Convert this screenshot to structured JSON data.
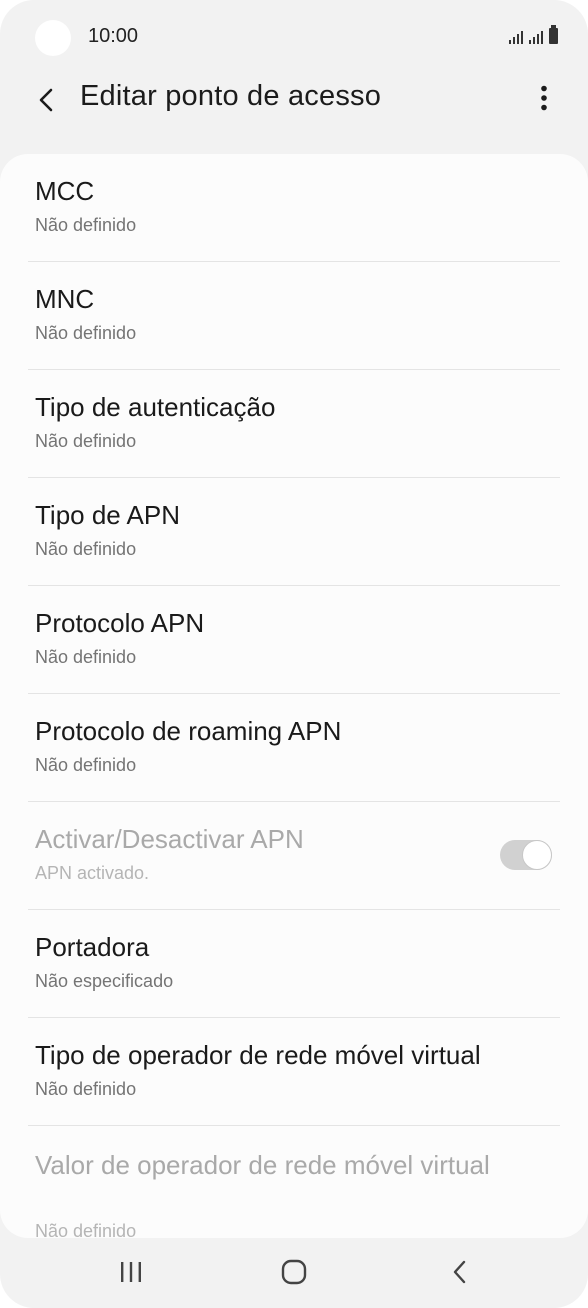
{
  "status_bar": {
    "time": "10:00",
    "icons": [
      "signal-icon",
      "signal-icon",
      "battery-icon"
    ]
  },
  "app_bar": {
    "title": "Editar ponto de acesso",
    "back_icon": "chevron-left-icon",
    "more_icon": "more-vertical-icon"
  },
  "settings": {
    "mcc": {
      "title": "MCC",
      "value": "Não definido"
    },
    "mnc": {
      "title": "MNC",
      "value": "Não definido"
    },
    "auth_type": {
      "title": "Tipo de autenticação",
      "value": "Não definido"
    },
    "apn_type": {
      "title": "Tipo de APN",
      "value": "Não definido"
    },
    "apn_protocol": {
      "title": "Protocolo APN",
      "value": "Não definido"
    },
    "apn_roaming_protocol": {
      "title": "Protocolo de roaming APN",
      "value": "Não definido"
    },
    "apn_enable": {
      "title": "Activar/Desactivar APN",
      "value": "APN activado.",
      "toggle_on": true,
      "disabled": true
    },
    "bearer": {
      "title": "Portadora",
      "value": "Não especificado"
    },
    "mvno_type": {
      "title": "Tipo de operador de rede móvel virtual",
      "value": "Não definido"
    },
    "mvno_value": {
      "title": "Valor de operador de rede móvel virtual",
      "value": "Não definido",
      "disabled": true
    }
  },
  "nav_bar": {
    "recents_icon": "recents-icon",
    "home_icon": "home-icon",
    "back_icon": "back-icon"
  },
  "colors": {
    "background": "#f2f2f2",
    "card": "#fcfcfc",
    "primary_text": "#1a1a1a",
    "secondary_text": "#747474",
    "disabled_text": "#a9a9a9"
  }
}
